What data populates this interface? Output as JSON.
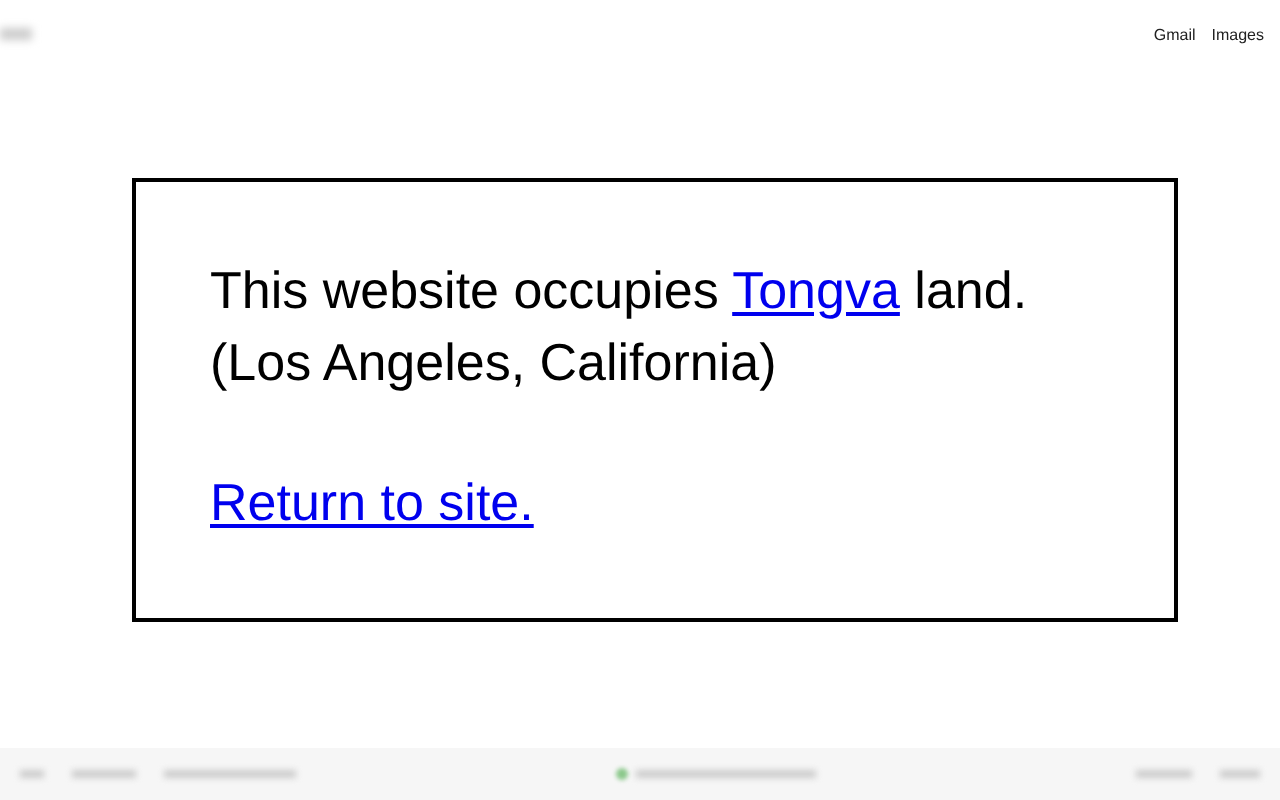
{
  "header": {
    "links": [
      "Gmail",
      "Images"
    ]
  },
  "notice": {
    "text_before": "This website occupies ",
    "link": "Tongva",
    "text_after": " land. (Los Angeles, California)",
    "return_link": "Return to site."
  }
}
